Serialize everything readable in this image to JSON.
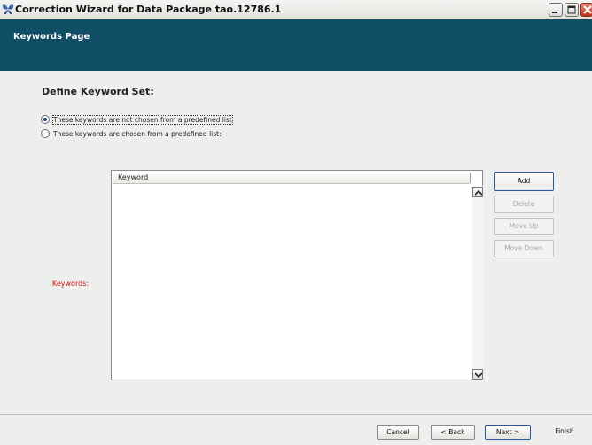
{
  "window": {
    "title": "Correction Wizard for Data Package tao.12786.1",
    "icon": "butterfly-icon",
    "controls": [
      "minimize-icon",
      "maximize-icon",
      "close-icon"
    ]
  },
  "header": {
    "title": "Keywords Page",
    "background": "#104e66"
  },
  "section": {
    "title": "Define Keyword Set:",
    "options": [
      {
        "label": "These keywords are not chosen from a predefined list",
        "selected": true
      },
      {
        "label": "These keywords are chosen from a predefined list:",
        "selected": false
      }
    ]
  },
  "keywords": {
    "label": "Keywords:",
    "label_color": "#c81414",
    "columns": [
      "Keyword"
    ],
    "rows": []
  },
  "side_buttons": {
    "add": "Add",
    "delete": "Delete",
    "move_up": "Move Up",
    "move_down": "Move Down"
  },
  "footer": {
    "cancel": "Cancel",
    "back": "< Back",
    "next": "Next >",
    "finish": "Finish"
  }
}
